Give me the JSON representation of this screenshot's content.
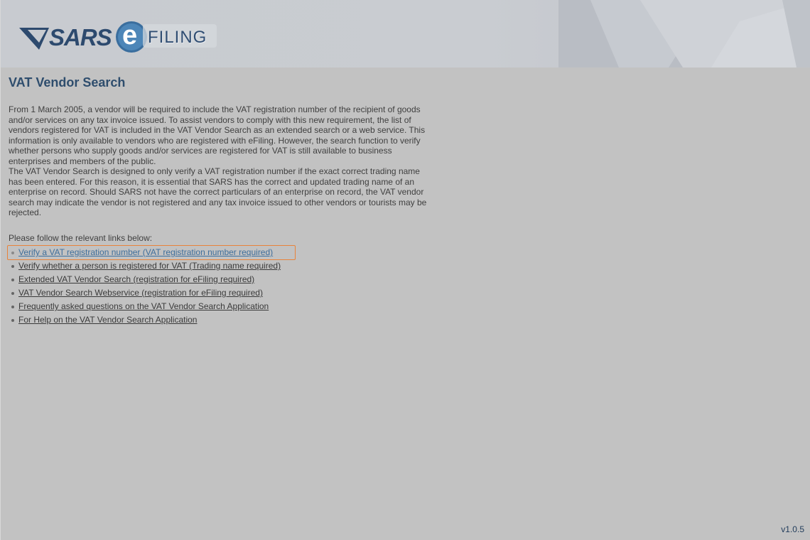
{
  "header": {
    "logo_sars": "SARS",
    "logo_e": "e",
    "logo_filing": "FILING"
  },
  "page_title": "VAT Vendor Search",
  "intro": {
    "paragraph1": "From 1 March 2005, a vendor will be required to include the VAT registration number of the recipient of goods and/or services on any tax invoice issued. To assist vendors to comply with this new requirement, the list of vendors registered for VAT is included in the VAT Vendor Search as an extended search or a web service. This information is only available to vendors who are registered with eFiling. However, the search function to verify whether persons who supply goods and/or services are registered for VAT is still available to business enterprises and members of the public.",
    "paragraph2": "The VAT Vendor Search is designed to only verify a VAT registration number if the exact correct trading name has been entered. For this reason, it is essential that SARS has the correct and updated trading name of an enterprise on record. Should SARS not have the correct particulars of an enterprise on record, the VAT vendor search may indicate the vendor is not registered and any tax invoice issued to other vendors or tourists may be rejected."
  },
  "follow_text": "Please follow the relevant links below:",
  "links": [
    {
      "label": "Verify a VAT registration number (VAT registration number required)"
    },
    {
      "label": "Verify whether a person is registered for VAT (Trading name required)"
    },
    {
      "label": "Extended VAT Vendor Search (registration for eFiling required)"
    },
    {
      "label": "VAT Vendor Search Webservice (registration for eFiling required)"
    },
    {
      "label": "Frequently asked questions on the VAT Vendor Search Application"
    },
    {
      "label": "For Help on the VAT Vendor Search Application"
    }
  ],
  "version": "v1.0.5",
  "colors": {
    "background": "#c2c2c2",
    "title": "#2e4d6d",
    "highlight_border": "#e8833a",
    "active_link": "#3f6f9c"
  }
}
